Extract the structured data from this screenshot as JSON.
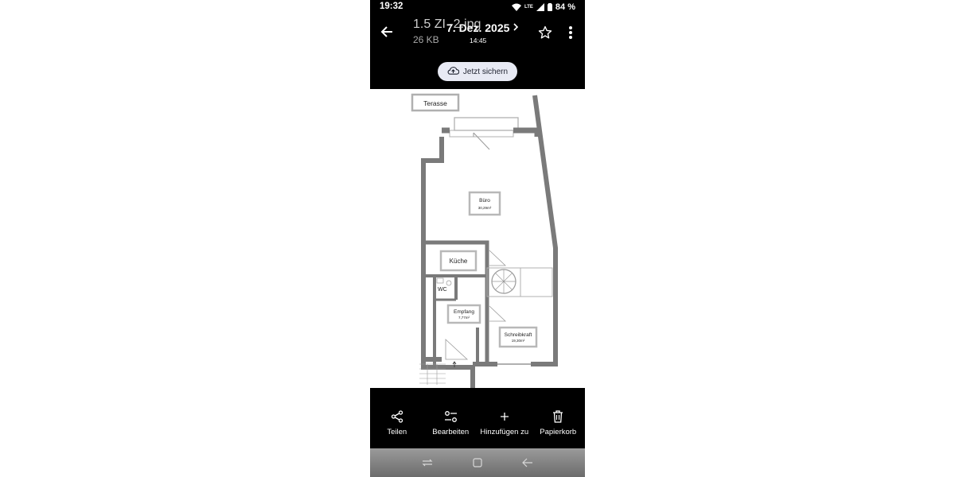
{
  "status": {
    "time": "19:32",
    "network": "LTE",
    "battery": "84 %"
  },
  "header": {
    "file_title": "1.5 ZI -2.jpg",
    "file_size": "26 KB",
    "date": "7. Dez. 2025",
    "time": "14:45"
  },
  "save_button": {
    "label": "Jetzt sichern"
  },
  "floorplan": {
    "terrace": "Terasse",
    "office": "Büro",
    "office_area": "30,29m²",
    "kitchen": "Küche",
    "wc": "WC",
    "reception": "Empfang",
    "reception_area": "7,77m²",
    "clerk": "Schreibkraft",
    "clerk_area": "19,30m²"
  },
  "actions": [
    {
      "label": "Teilen",
      "icon": "share-icon"
    },
    {
      "label": "Bearbeiten",
      "icon": "edit-sliders-icon"
    },
    {
      "label": "Hinzufügen zu",
      "icon": "plus-icon"
    },
    {
      "label": "Papierkorb",
      "icon": "trash-icon"
    }
  ],
  "colors": {
    "background": "#000000",
    "save_button_bg": "#e8eaf4",
    "wall": "#7a7a7a"
  }
}
